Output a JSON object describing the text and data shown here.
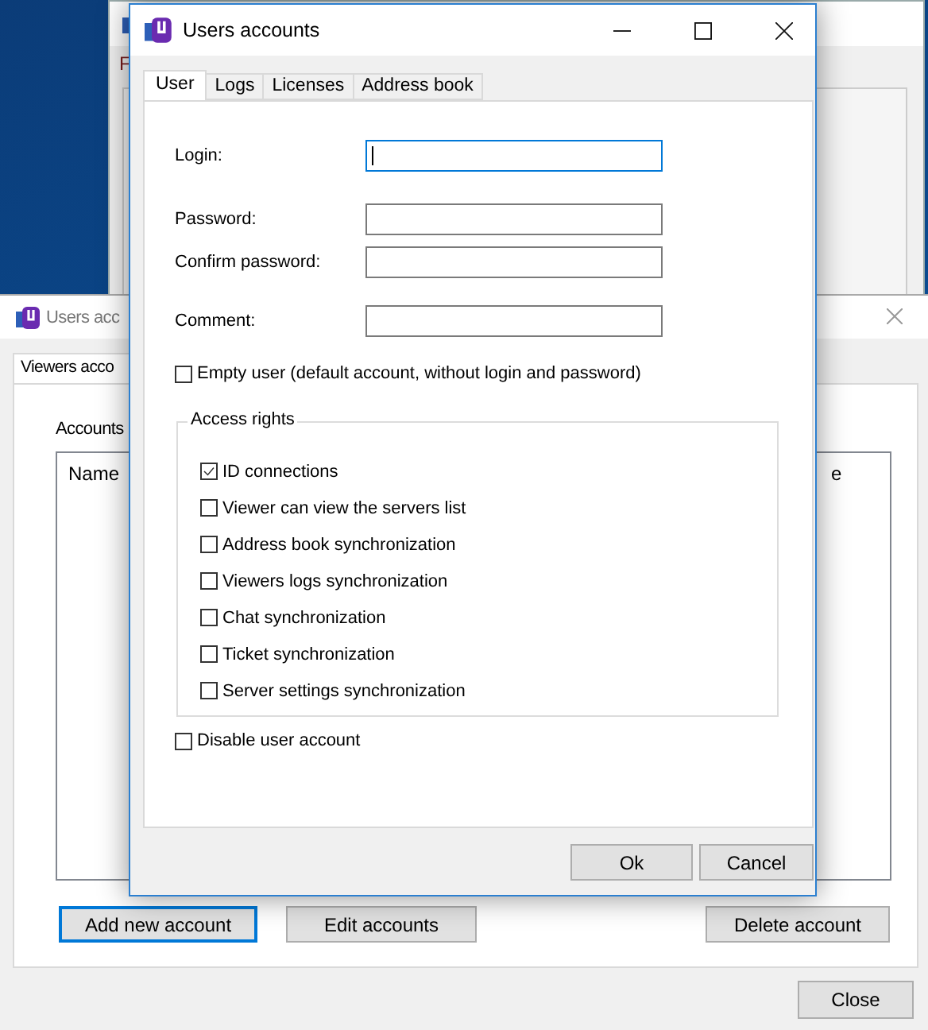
{
  "back_window_top": {
    "menu_item": "F"
  },
  "back_window": {
    "title": "Users acc",
    "tabs": [
      {
        "label": "Viewers acco",
        "selected": true
      }
    ],
    "group_label": "Accounts",
    "columns": [
      "Name",
      "e"
    ],
    "buttons": [
      {
        "label": "Add new account",
        "focused": true
      },
      {
        "label": "Edit accounts",
        "focused": false
      },
      {
        "label": "Delete account",
        "focused": false
      }
    ],
    "close_button": "Close"
  },
  "dialog": {
    "title": "Users accounts",
    "tabs": [
      {
        "label": "User",
        "selected": true
      },
      {
        "label": "Logs",
        "selected": false
      },
      {
        "label": "Licenses",
        "selected": false
      },
      {
        "label": "Address book",
        "selected": false
      }
    ],
    "fields": [
      {
        "label": "Login:",
        "focused": true
      },
      {
        "label": "Password:",
        "focused": false
      },
      {
        "label": "Confirm password:",
        "focused": false
      },
      {
        "label": "Comment:",
        "focused": false
      }
    ],
    "empty_user": {
      "label": "Empty user (default account, without login and password)",
      "checked": false
    },
    "access_rights": {
      "title": "Access rights",
      "items": [
        {
          "label": "ID connections",
          "checked": true
        },
        {
          "label": "Viewer can view the servers list",
          "checked": false
        },
        {
          "label": "Address book synchronization",
          "checked": false
        },
        {
          "label": "Viewers logs synchronization",
          "checked": false
        },
        {
          "label": "Chat synchronization",
          "checked": false
        },
        {
          "label": "Ticket synchronization",
          "checked": false
        },
        {
          "label": "Server settings synchronization",
          "checked": false
        }
      ]
    },
    "disable_account": {
      "label": "Disable user account",
      "checked": false
    },
    "buttons": [
      "Ok",
      "Cancel"
    ]
  }
}
